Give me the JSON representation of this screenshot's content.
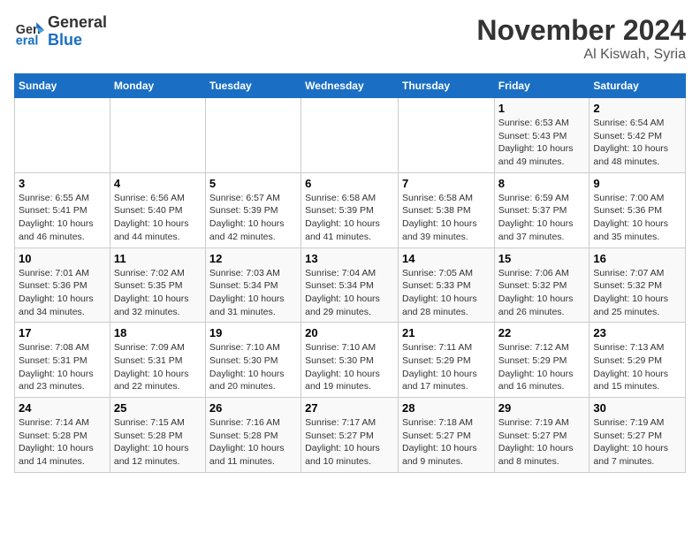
{
  "logo": {
    "line1": "General",
    "line2": "Blue"
  },
  "title": "November 2024",
  "location": "Al Kiswah, Syria",
  "days_header": [
    "Sunday",
    "Monday",
    "Tuesday",
    "Wednesday",
    "Thursday",
    "Friday",
    "Saturday"
  ],
  "weeks": [
    [
      {
        "day": "",
        "info": ""
      },
      {
        "day": "",
        "info": ""
      },
      {
        "day": "",
        "info": ""
      },
      {
        "day": "",
        "info": ""
      },
      {
        "day": "",
        "info": ""
      },
      {
        "day": "1",
        "info": "Sunrise: 6:53 AM\nSunset: 5:43 PM\nDaylight: 10 hours\nand 49 minutes."
      },
      {
        "day": "2",
        "info": "Sunrise: 6:54 AM\nSunset: 5:42 PM\nDaylight: 10 hours\nand 48 minutes."
      }
    ],
    [
      {
        "day": "3",
        "info": "Sunrise: 6:55 AM\nSunset: 5:41 PM\nDaylight: 10 hours\nand 46 minutes."
      },
      {
        "day": "4",
        "info": "Sunrise: 6:56 AM\nSunset: 5:40 PM\nDaylight: 10 hours\nand 44 minutes."
      },
      {
        "day": "5",
        "info": "Sunrise: 6:57 AM\nSunset: 5:39 PM\nDaylight: 10 hours\nand 42 minutes."
      },
      {
        "day": "6",
        "info": "Sunrise: 6:58 AM\nSunset: 5:39 PM\nDaylight: 10 hours\nand 41 minutes."
      },
      {
        "day": "7",
        "info": "Sunrise: 6:58 AM\nSunset: 5:38 PM\nDaylight: 10 hours\nand 39 minutes."
      },
      {
        "day": "8",
        "info": "Sunrise: 6:59 AM\nSunset: 5:37 PM\nDaylight: 10 hours\nand 37 minutes."
      },
      {
        "day": "9",
        "info": "Sunrise: 7:00 AM\nSunset: 5:36 PM\nDaylight: 10 hours\nand 35 minutes."
      }
    ],
    [
      {
        "day": "10",
        "info": "Sunrise: 7:01 AM\nSunset: 5:36 PM\nDaylight: 10 hours\nand 34 minutes."
      },
      {
        "day": "11",
        "info": "Sunrise: 7:02 AM\nSunset: 5:35 PM\nDaylight: 10 hours\nand 32 minutes."
      },
      {
        "day": "12",
        "info": "Sunrise: 7:03 AM\nSunset: 5:34 PM\nDaylight: 10 hours\nand 31 minutes."
      },
      {
        "day": "13",
        "info": "Sunrise: 7:04 AM\nSunset: 5:34 PM\nDaylight: 10 hours\nand 29 minutes."
      },
      {
        "day": "14",
        "info": "Sunrise: 7:05 AM\nSunset: 5:33 PM\nDaylight: 10 hours\nand 28 minutes."
      },
      {
        "day": "15",
        "info": "Sunrise: 7:06 AM\nSunset: 5:32 PM\nDaylight: 10 hours\nand 26 minutes."
      },
      {
        "day": "16",
        "info": "Sunrise: 7:07 AM\nSunset: 5:32 PM\nDaylight: 10 hours\nand 25 minutes."
      }
    ],
    [
      {
        "day": "17",
        "info": "Sunrise: 7:08 AM\nSunset: 5:31 PM\nDaylight: 10 hours\nand 23 minutes."
      },
      {
        "day": "18",
        "info": "Sunrise: 7:09 AM\nSunset: 5:31 PM\nDaylight: 10 hours\nand 22 minutes."
      },
      {
        "day": "19",
        "info": "Sunrise: 7:10 AM\nSunset: 5:30 PM\nDaylight: 10 hours\nand 20 minutes."
      },
      {
        "day": "20",
        "info": "Sunrise: 7:10 AM\nSunset: 5:30 PM\nDaylight: 10 hours\nand 19 minutes."
      },
      {
        "day": "21",
        "info": "Sunrise: 7:11 AM\nSunset: 5:29 PM\nDaylight: 10 hours\nand 17 minutes."
      },
      {
        "day": "22",
        "info": "Sunrise: 7:12 AM\nSunset: 5:29 PM\nDaylight: 10 hours\nand 16 minutes."
      },
      {
        "day": "23",
        "info": "Sunrise: 7:13 AM\nSunset: 5:29 PM\nDaylight: 10 hours\nand 15 minutes."
      }
    ],
    [
      {
        "day": "24",
        "info": "Sunrise: 7:14 AM\nSunset: 5:28 PM\nDaylight: 10 hours\nand 14 minutes."
      },
      {
        "day": "25",
        "info": "Sunrise: 7:15 AM\nSunset: 5:28 PM\nDaylight: 10 hours\nand 12 minutes."
      },
      {
        "day": "26",
        "info": "Sunrise: 7:16 AM\nSunset: 5:28 PM\nDaylight: 10 hours\nand 11 minutes."
      },
      {
        "day": "27",
        "info": "Sunrise: 7:17 AM\nSunset: 5:27 PM\nDaylight: 10 hours\nand 10 minutes."
      },
      {
        "day": "28",
        "info": "Sunrise: 7:18 AM\nSunset: 5:27 PM\nDaylight: 10 hours\nand 9 minutes."
      },
      {
        "day": "29",
        "info": "Sunrise: 7:19 AM\nSunset: 5:27 PM\nDaylight: 10 hours\nand 8 minutes."
      },
      {
        "day": "30",
        "info": "Sunrise: 7:19 AM\nSunset: 5:27 PM\nDaylight: 10 hours\nand 7 minutes."
      }
    ]
  ]
}
